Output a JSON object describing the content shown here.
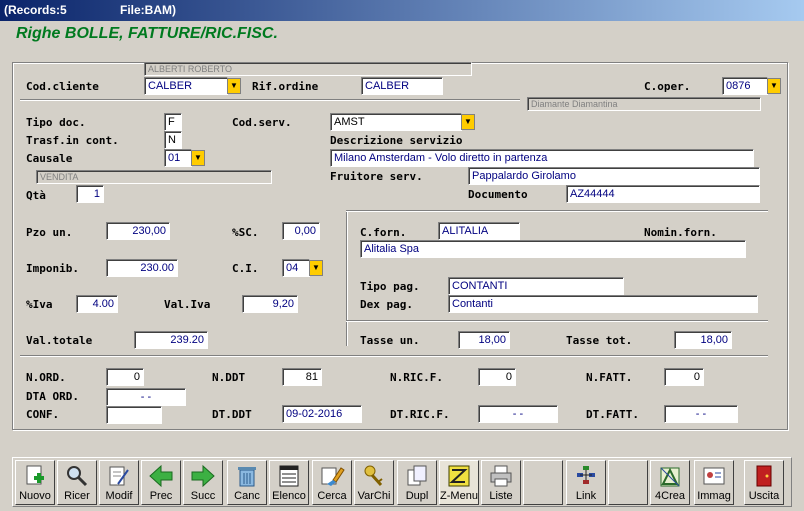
{
  "window": {
    "records": "(Records:5",
    "file": "File:BAM)"
  },
  "form_title": "Righe BOLLE, FATTURE/RIC.FISC.",
  "header": {
    "customer_name": "ALBERTI ROBERTO",
    "cod_cliente_label": "Cod.cliente",
    "cod_cliente": "CALBER",
    "rif_ordine_label": "Rif.ordine",
    "rif_ordine": "CALBER",
    "c_oper_label": "C.oper.",
    "c_oper": "0876",
    "operator_name": "Diamante Diamantina"
  },
  "left": {
    "tipo_doc_label": "Tipo doc.",
    "tipo_doc": "F",
    "trasf_label": "Trasf.in cont.",
    "trasf": "N",
    "causale_label": "Causale",
    "causale": "01",
    "causale_desc": "VENDITA",
    "qta_label": "Qtà",
    "qta": "1"
  },
  "service": {
    "cod_serv_label": "Cod.serv.",
    "cod_serv": "AMST",
    "desc_label": "Descrizione servizio",
    "desc": "Milano Amsterdam - Volo diretto in partenza",
    "fruitore_label": "Fruitore serv.",
    "fruitore": "Pappalardo Girolamo",
    "documento_label": "Documento",
    "documento": "AZ44444"
  },
  "prices": {
    "pzo_label": "Pzo un.",
    "pzo": "230,00",
    "sc_label": "%SC.",
    "sc": "0,00",
    "imponib_label": "Imponib.",
    "imponib": "230.00",
    "ci_label": "C.I.",
    "ci": "04",
    "iva_label": "%Iva",
    "iva": "4.00",
    "valiva_label": "Val.Iva",
    "valiva": "9,20",
    "valtot_label": "Val.totale",
    "valtot": "239.20"
  },
  "supplier": {
    "cforn_label": "C.forn.",
    "cforn": "ALITALIA",
    "nomin_label": "Nomin.forn.",
    "nomin": "Alitalia Spa",
    "tipopag_label": "Tipo pag.",
    "tipopag": "CONTANTI",
    "dexpag_label": "Dex pag.",
    "dexpag": "Contanti",
    "tasseun_label": "Tasse un.",
    "tasseun": "18,00",
    "tassetot_label": "Tasse tot.",
    "tassetot": "18,00"
  },
  "refs": {
    "nord_label": "N.ORD.",
    "nord": "0",
    "dtaord_label": "DTA ORD.",
    "dtaord": "-   -",
    "conf_label": "CONF.",
    "conf": "",
    "nddt_label": "N.DDT",
    "nddt": "81",
    "dtddt_label": "DT.DDT",
    "dtddt": "09-02-2016",
    "nricf_label": "N.RIC.F.",
    "nricf": "0",
    "dtricf_label": "DT.RIC.F.",
    "dtricf": "-   -",
    "nfatt_label": "N.FATT.",
    "nfatt": "0",
    "dtfatt_label": "DT.FATT.",
    "dtfatt": "-   -"
  },
  "toolbar": [
    {
      "label": "Nuovo",
      "icon": "new-doc-icon"
    },
    {
      "label": "Ricer",
      "icon": "search-icon"
    },
    {
      "label": "Modif",
      "icon": "edit-icon"
    },
    {
      "label": "Prec",
      "icon": "arrow-left-icon"
    },
    {
      "label": "Succ",
      "icon": "arrow-right-icon"
    },
    {
      "label": "Canc",
      "icon": "trash-icon"
    },
    {
      "label": "Elenco",
      "icon": "list-icon"
    },
    {
      "label": "Cerca",
      "icon": "find-icon"
    },
    {
      "label": "VarChi",
      "icon": "keys-icon"
    },
    {
      "label": "Dupl",
      "icon": "duplicate-icon"
    },
    {
      "label": "Z-Menu",
      "icon": "menu-icon"
    },
    {
      "label": "Liste",
      "icon": "printer-icon"
    },
    {
      "label": "",
      "icon": ""
    },
    {
      "label": "Link",
      "icon": "link-icon"
    },
    {
      "label": "",
      "icon": ""
    },
    {
      "label": "4Crea",
      "icon": "create-icon"
    },
    {
      "label": "Immag",
      "icon": "image-card-icon"
    },
    {
      "label": "Uscita",
      "icon": "exit-door-icon"
    }
  ],
  "colors": {
    "title_green": "#007a1f",
    "combo_yellow": "#ffcc00",
    "titlebar": "#0a246a"
  }
}
